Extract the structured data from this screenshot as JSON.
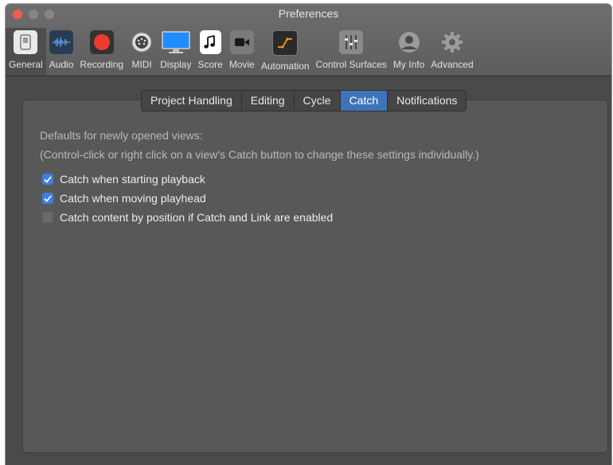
{
  "window": {
    "title": "Preferences"
  },
  "toolbar": {
    "items": [
      {
        "label": "General",
        "icon": "switch-icon",
        "active": true
      },
      {
        "label": "Audio",
        "icon": "waveform-icon",
        "active": false
      },
      {
        "label": "Recording",
        "icon": "record-icon",
        "active": false
      },
      {
        "label": "MIDI",
        "icon": "midi-port-icon",
        "active": false
      },
      {
        "label": "Display",
        "icon": "monitor-icon",
        "active": false
      },
      {
        "label": "Score",
        "icon": "music-note-icon",
        "active": false
      },
      {
        "label": "Movie",
        "icon": "video-camera-icon",
        "active": false
      },
      {
        "label": "Automation",
        "icon": "automation-curve-icon",
        "active": false
      },
      {
        "label": "Control Surfaces",
        "icon": "faders-icon",
        "active": false
      },
      {
        "label": "My Info",
        "icon": "user-icon",
        "active": false
      },
      {
        "label": "Advanced",
        "icon": "gear-icon",
        "active": false
      }
    ]
  },
  "tabs": [
    {
      "label": "Project Handling",
      "selected": false
    },
    {
      "label": "Editing",
      "selected": false
    },
    {
      "label": "Cycle",
      "selected": false
    },
    {
      "label": "Catch",
      "selected": true
    },
    {
      "label": "Notifications",
      "selected": false
    }
  ],
  "content": {
    "heading": "Defaults for newly opened views:",
    "note": "(Control-click or right click on a view's Catch button to change these settings individually.)",
    "options": [
      {
        "label": "Catch when starting playback",
        "checked": true
      },
      {
        "label": "Catch when moving playhead",
        "checked": true
      },
      {
        "label": "Catch content by position if Catch and Link are enabled",
        "checked": false
      }
    ]
  },
  "colors": {
    "accent": "#3d74b8",
    "checkbox": "#3d7ee0",
    "close": "#ee5b56"
  }
}
